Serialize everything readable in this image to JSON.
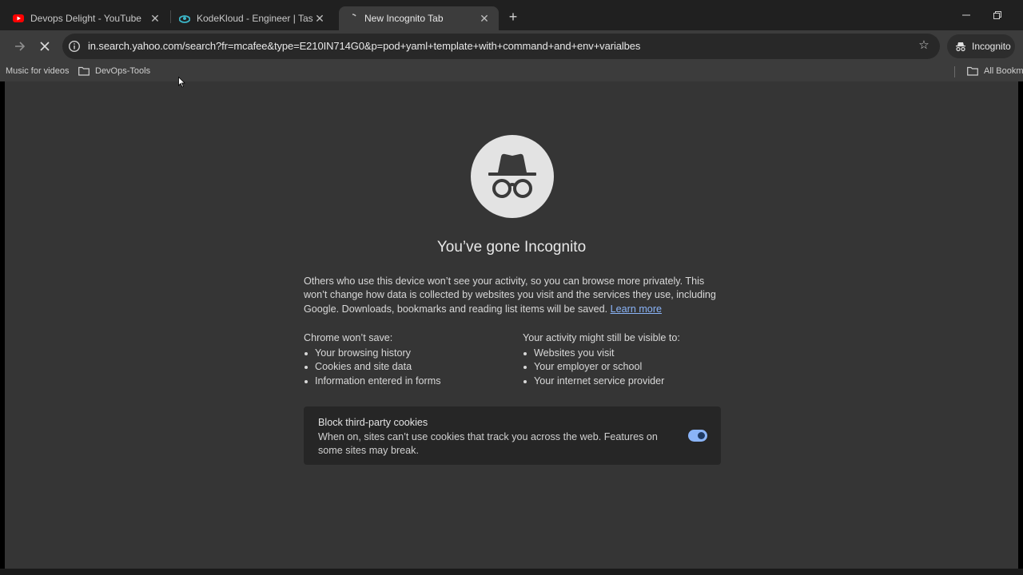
{
  "tabs": [
    {
      "title": "Devops Delight - YouTube",
      "favicon": "youtube-icon",
      "active": false
    },
    {
      "title": "KodeKloud - Engineer | Task",
      "favicon": "kodekloud-icon",
      "active": false
    },
    {
      "title": "New Incognito Tab",
      "favicon": "loading-spinner-icon",
      "active": true
    }
  ],
  "tab_close_glyph": "✕",
  "new_tab_glyph": "+",
  "toolbar": {
    "url": "in.search.yahoo.com/search?fr=mcafee&type=E210IN714G0&p=pod+yaml+template+with+command+and+env+varialbes",
    "incognito_label": "Incognito"
  },
  "bookmarks": {
    "items": [
      {
        "label": "Music for videos",
        "folder": false
      },
      {
        "label": "DevOps-Tools",
        "folder": true
      }
    ],
    "all_bookmarks": "All Bookmarks"
  },
  "page": {
    "heading": "You’ve gone Incognito",
    "intro": "Others who use this device won’t see your activity, so you can browse more privately. This won’t change how data is collected by websites you visit and the services they use, including Google. Downloads, bookmarks and reading list items will be saved.",
    "learn_more": "Learn more",
    "wont_save_heading": "Chrome won’t save:",
    "wont_save_items": [
      "Your browsing history",
      "Cookies and site data",
      "Information entered in forms"
    ],
    "visible_heading": "Your activity might still be visible to:",
    "visible_items": [
      "Websites you visit",
      "Your employer or school",
      "Your internet service provider"
    ],
    "cookie_card": {
      "title": "Block third-party cookies",
      "description": "When on, sites can’t use cookies that track you across the web. Features on some sites may break.",
      "toggle_on": true
    }
  },
  "colors": {
    "page_bg": "#353535",
    "toolbar_bg": "#3c3c3c",
    "link": "#8ab4f8",
    "toggle": "#8ab4f8"
  }
}
